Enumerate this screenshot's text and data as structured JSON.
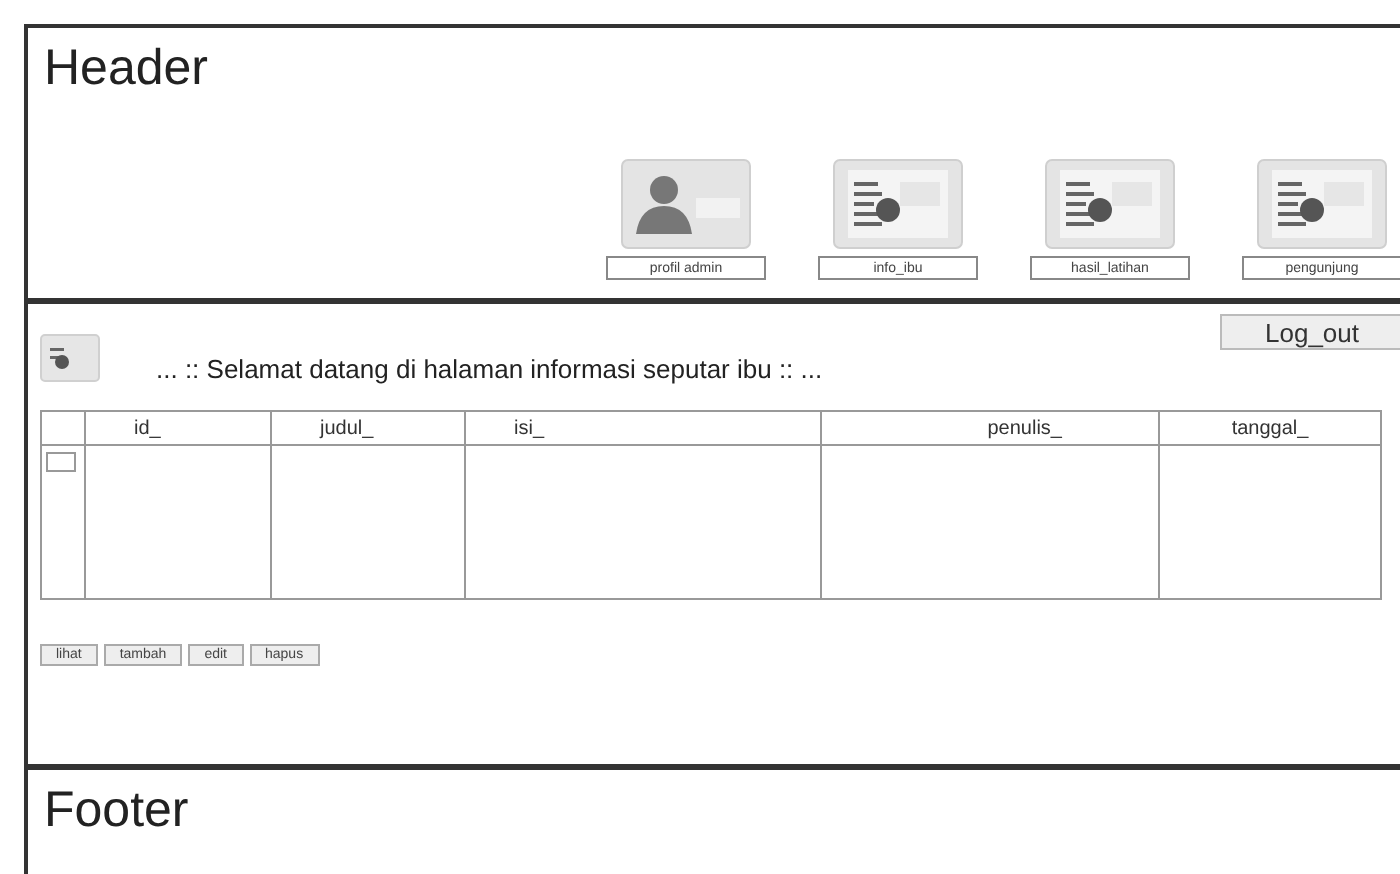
{
  "header": {
    "title": "Header",
    "nav": [
      {
        "label": "profil admin",
        "kind": "person"
      },
      {
        "label": "info_ibu",
        "kind": "document"
      },
      {
        "label": "hasil_latihan",
        "kind": "document"
      },
      {
        "label": "pengunjung",
        "kind": "document"
      }
    ]
  },
  "content": {
    "logout": "Log_out",
    "welcome": "... :: Selamat datang di halaman informasi seputar ibu :: ...",
    "table": {
      "columns": [
        {
          "label": "id_"
        },
        {
          "label": "judul_"
        },
        {
          "label": "isi_"
        },
        {
          "label": "penulis_"
        },
        {
          "label": "tanggal_"
        }
      ],
      "rows": [
        {
          "checked": false
        }
      ]
    },
    "actions": [
      "lihat",
      "tambah",
      "edit",
      "hapus"
    ]
  },
  "footer": {
    "title": "Footer"
  }
}
